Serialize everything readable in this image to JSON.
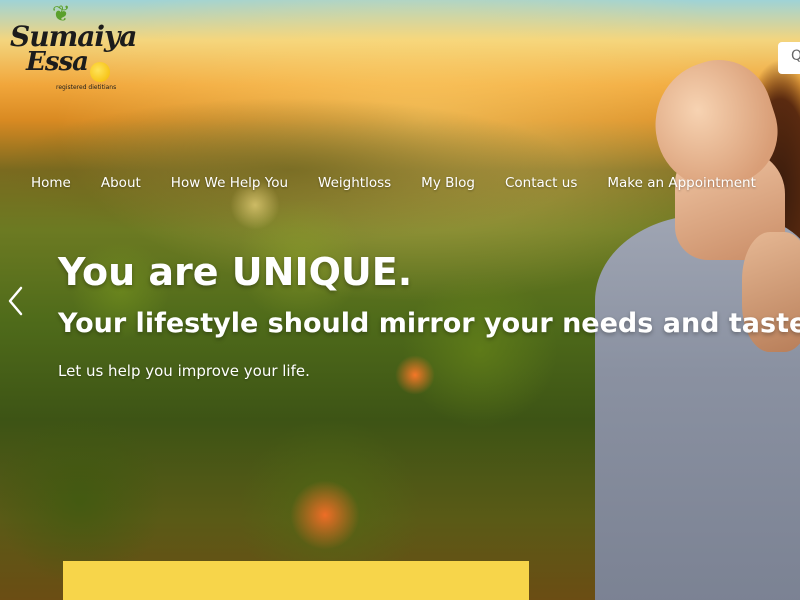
{
  "brand": {
    "name_line1": "Sumaiya",
    "name_line2": "Essa",
    "tagline": "registered dietitians"
  },
  "nav": {
    "items": [
      {
        "label": "Home"
      },
      {
        "label": "About"
      },
      {
        "label": "How We Help You"
      },
      {
        "label": "Weightloss"
      },
      {
        "label": "My Blog"
      },
      {
        "label": "Contact us"
      },
      {
        "label": "Make an Appointment"
      }
    ]
  },
  "search": {
    "icon": "search-icon",
    "partial_glyph": "Q"
  },
  "hero": {
    "headline": "You are UNIQUE.",
    "subheadline": "Your lifestyle should mirror your needs and taste",
    "body": "Let us help you improve your life.",
    "prev_icon": "chevron-left-icon"
  },
  "colors": {
    "cta_bar": "#f7d54a",
    "logo_leaf": "#5aa02c",
    "logo_lemon": "#f4b700",
    "text": "#ffffff"
  }
}
